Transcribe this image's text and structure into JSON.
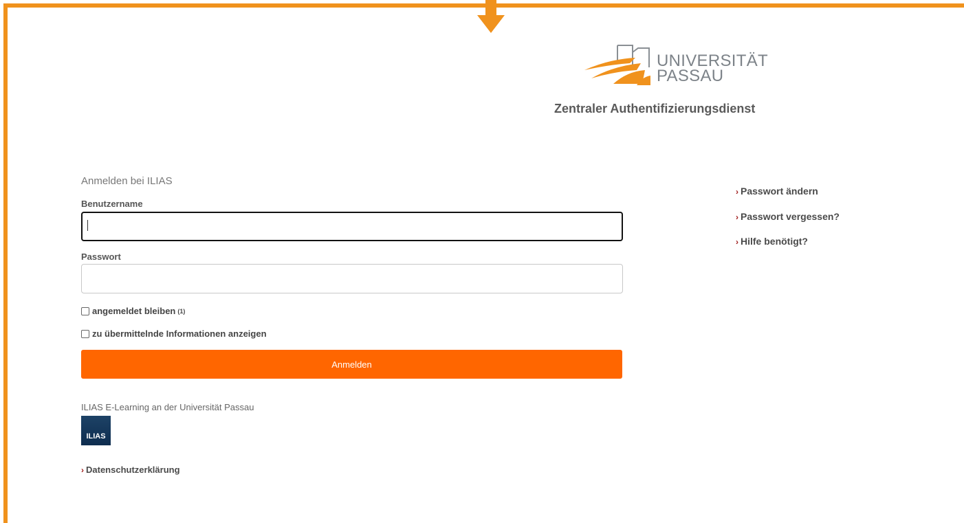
{
  "brand": {
    "logo_line1": "UNIVERSITÄT",
    "logo_line2": "PASSAU",
    "subtitle": "Zentraler Authentifizierungsdienst",
    "frame_color": "#f0921d",
    "accent_color": "#ff6600"
  },
  "login": {
    "heading": "Anmelden bei ILIAS",
    "username_label": "Benutzername",
    "username_value": "",
    "password_label": "Passwort",
    "password_value": "",
    "remember_label": "angemeldet bleiben",
    "remember_sup": "(1)",
    "remember_checked": false,
    "show_info_label": "zu übermittelnde Informationen anzeigen",
    "show_info_checked": false,
    "submit_label": "Anmelden"
  },
  "service": {
    "description": "ILIAS E-Learning an der Universität Passau",
    "logo_text": "ILIAS",
    "privacy_link": "Datenschutzerklärung"
  },
  "side_links": {
    "change_password": "Passwort ändern",
    "forgot_password": "Passwort vergessen?",
    "help": "Hilfe benötigt?"
  }
}
